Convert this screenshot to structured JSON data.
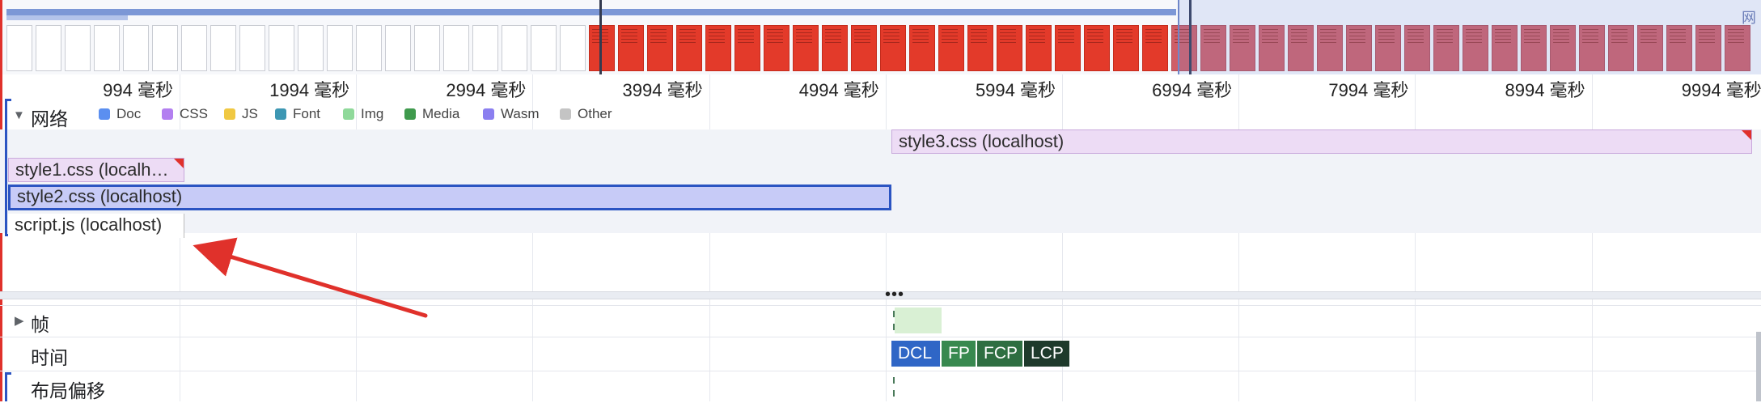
{
  "overview": {
    "label": "网",
    "thumbnails": {
      "blank_count": 20,
      "red_count": 20,
      "dim_count": 20
    }
  },
  "ruler": {
    "ticks": [
      "994 毫秒",
      "1994 毫秒",
      "2994 毫秒",
      "3994 毫秒",
      "4994 毫秒",
      "5994 毫秒",
      "6994 毫秒",
      "7994 毫秒",
      "8994 毫秒",
      "9994 毫秒"
    ]
  },
  "network": {
    "title": "网络",
    "legend": [
      {
        "label": "Doc",
        "color": "#5b8ff0"
      },
      {
        "label": "CSS",
        "color": "#b37ff0"
      },
      {
        "label": "JS",
        "color": "#f0c842"
      },
      {
        "label": "Font",
        "color": "#3d97b3"
      },
      {
        "label": "Img",
        "color": "#8fd99a"
      },
      {
        "label": "Media",
        "color": "#3f9a4d"
      },
      {
        "label": "Wasm",
        "color": "#8b7ff0"
      },
      {
        "label": "Other",
        "color": "#c4c4c4"
      }
    ],
    "requests": [
      {
        "label": "style3.css (localhost)",
        "type": "css"
      },
      {
        "label": "style1.css (localh…",
        "type": "css"
      },
      {
        "label": "style2.css (localhost)",
        "type": "css",
        "selected": true
      },
      {
        "label": "script.js (localhost)",
        "type": "js"
      }
    ]
  },
  "splitter": {
    "dots": "•••"
  },
  "tracks": {
    "frames": "帧",
    "timings": "时间",
    "layout_shifts": "布局偏移"
  },
  "markers": {
    "dcl": "DCL",
    "fp": "FP",
    "fcp": "FCP",
    "lcp": "LCP"
  },
  "colors": {
    "selection": "#2b54c2",
    "annotation_arrow": "#e0312b"
  }
}
